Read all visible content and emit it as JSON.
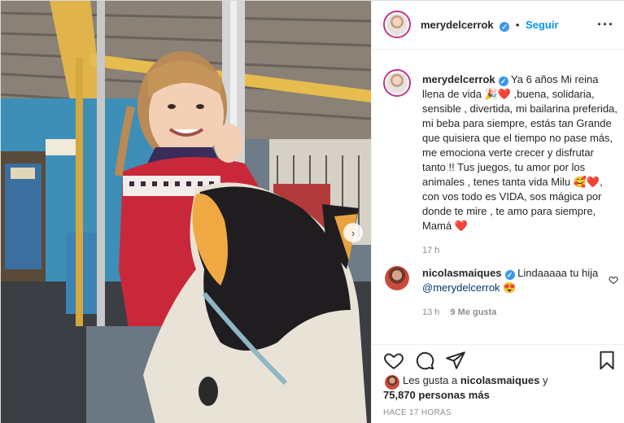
{
  "post": {
    "username": "merydelcerrok",
    "follow_label": "Seguir",
    "more_icon": "more-options-icon",
    "photo_alt": "",
    "caption_text": "Ya 6 años Mi reina llena de vida 🎉❤️ ,buena, solidaria, sensible , divertida, mi bailarina preferida, mi beba para siempre, estás tan Grande que quisiera que el tiempo no pase más, me emociona verte crecer y disfrutar tanto !! Tus juegos, tu amor por los animales , tenes tanta vida Milu 🥰❤️, con vos todo es VIDA, sos mágica por donde te mire , te amo para siempre, Mamá ❤️",
    "caption_time": "17 h",
    "comment": {
      "username": "nicolasmaiques",
      "text_before": "Lindaaaaa tu hija",
      "mention": "@merydelcerrok",
      "emoji": "😍",
      "time": "13 h",
      "likes": "9 Me gusta"
    },
    "likes_prefix": "Les gusta a",
    "likes_user": "nicolasmaiques",
    "likes_connector": "y",
    "likes_count": "75,870 personas más",
    "posted_time": "HACE 17 HORAS"
  },
  "colors": {
    "link": "#0095f6",
    "heart": "#ed4956"
  }
}
